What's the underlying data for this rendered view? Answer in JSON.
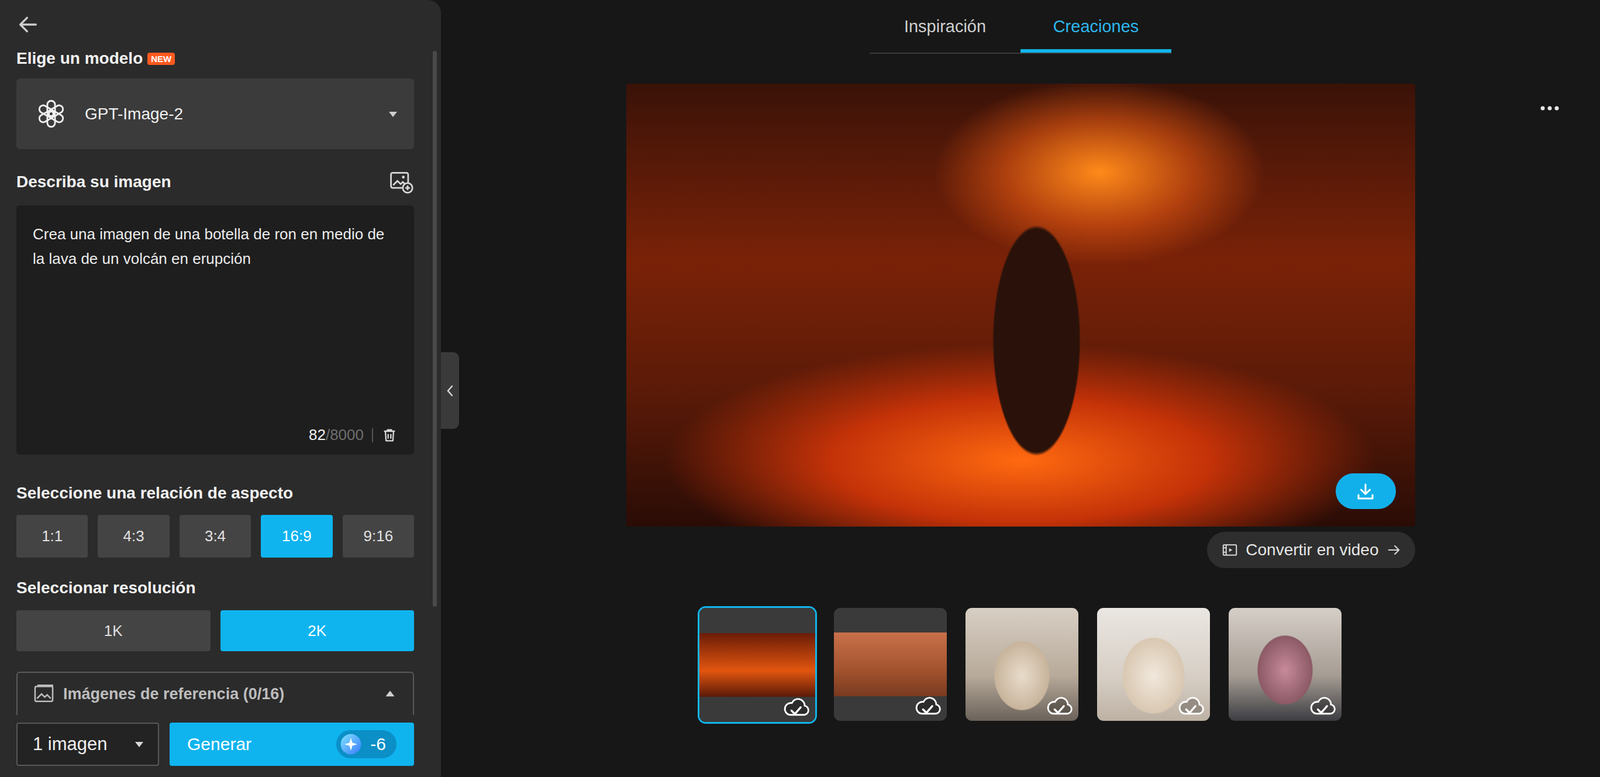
{
  "model": {
    "label": "Elige un modelo",
    "badge": "NEW",
    "value": "GPT-Image-2"
  },
  "prompt": {
    "label": "Describa su imagen",
    "value": "Crea una imagen de una botella de ron en medio de la lava de un volcán en erupción",
    "count": "82",
    "limit": "/8000"
  },
  "aspect_ratio": {
    "label": "Seleccione una relación de aspecto",
    "options": [
      {
        "label": "1:1",
        "selected": false
      },
      {
        "label": "4:3",
        "selected": false
      },
      {
        "label": "3:4",
        "selected": false
      },
      {
        "label": "16:9",
        "selected": true
      },
      {
        "label": "9:16",
        "selected": false
      }
    ]
  },
  "resolution": {
    "label": "Seleccionar resolución",
    "options": [
      {
        "label": "1K",
        "selected": false
      },
      {
        "label": "2K",
        "selected": true
      }
    ]
  },
  "reference_images": {
    "label": "Imágenes de referencia (0/16)",
    "expanded": true
  },
  "footer": {
    "count": "1 imagen",
    "generate": "Generar",
    "cost": "-6"
  },
  "tabs": [
    {
      "label": "Inspiración",
      "selected": false
    },
    {
      "label": "Creaciones",
      "selected": true
    }
  ],
  "preview": {
    "convert": "Convertir en video"
  },
  "thumbnails": [
    {
      "selected": true,
      "saved": true
    },
    {
      "selected": false,
      "saved": true
    },
    {
      "selected": false,
      "saved": true
    },
    {
      "selected": false,
      "saved": true
    },
    {
      "selected": false,
      "saved": true
    }
  ]
}
